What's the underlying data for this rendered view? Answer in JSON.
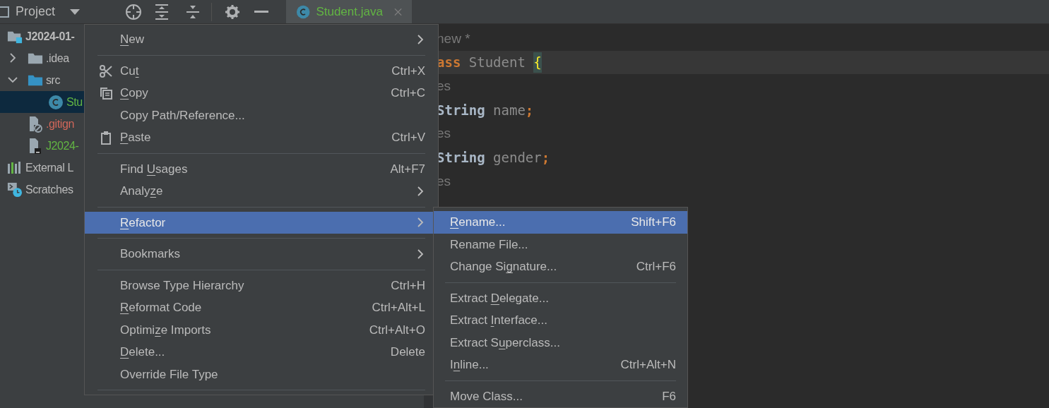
{
  "tool_window": {
    "title": "Project"
  },
  "editor_tabs": [
    {
      "label": "Student.java",
      "selected": true,
      "color": "#62b543"
    }
  ],
  "project_tree": [
    {
      "label": "J2024-01-",
      "kind": "module",
      "color": "#bbbbbb",
      "bold": true,
      "selected": false,
      "children": [
        {
          "label": ".idea",
          "kind": "folder",
          "color": "#bbbbbb",
          "expanded": false,
          "selected": false
        },
        {
          "label": "src",
          "kind": "source-folder",
          "color": "#bbbbbb",
          "expanded": true,
          "selected": false,
          "children": [
            {
              "label": "Stu",
              "kind": "class",
              "color": "#62b543",
              "selected": true
            }
          ]
        },
        {
          "label": ".gitign",
          "kind": "ignored-file",
          "color": "#d1675a",
          "selected": false
        },
        {
          "label": "J2024-",
          "kind": "module-file",
          "color": "#62b543",
          "selected": false
        }
      ]
    },
    {
      "label": "External L",
      "kind": "libraries",
      "color": "#bbbbbb",
      "selected": false
    },
    {
      "label": "Scratches",
      "kind": "scratches",
      "color": "#bbbbbb",
      "selected": false
    }
  ],
  "code_lines": [
    {
      "tokens": [
        {
          "text": "new *",
          "kind": "hint"
        }
      ]
    },
    {
      "tokens": [
        {
          "text": "ass",
          "kind": "keyword"
        },
        {
          "text": " Student ",
          "kind": "unused"
        },
        {
          "text": "{",
          "kind": "brace"
        }
      ],
      "current": true
    },
    {
      "tokens": [
        {
          "text": "es",
          "kind": "hint"
        }
      ]
    },
    {
      "tokens": [
        {
          "text": "String",
          "kind": "plain"
        },
        {
          "text": " name",
          "kind": "unused"
        },
        {
          "text": ";",
          "kind": "keyword"
        }
      ]
    },
    {
      "tokens": [
        {
          "text": "es",
          "kind": "hint"
        }
      ]
    },
    {
      "tokens": [
        {
          "text": "String",
          "kind": "plain"
        },
        {
          "text": " gender",
          "kind": "unused"
        },
        {
          "text": ";",
          "kind": "keyword"
        }
      ]
    },
    {
      "tokens": [
        {
          "text": "es",
          "kind": "hint"
        }
      ]
    }
  ],
  "context_menu": [
    {
      "kind": "item",
      "label": [
        {
          "text": "N",
          "underlined": true
        },
        {
          "text": "ew",
          "underlined": false
        }
      ],
      "submenu": true,
      "selected": false
    },
    {
      "kind": "separator"
    },
    {
      "kind": "cut",
      "label": [
        {
          "text": "Cu",
          "underlined": false
        },
        {
          "text": "t",
          "underlined": true
        }
      ],
      "shortcut": "Ctrl+X",
      "selected": false
    },
    {
      "kind": "copy",
      "label": [
        {
          "text": "C",
          "underlined": true
        },
        {
          "text": "opy",
          "underlined": false
        }
      ],
      "shortcut": "Ctrl+C",
      "selected": false
    },
    {
      "kind": "item",
      "label": [
        {
          "text": "Copy Path/Reference...",
          "underlined": false
        }
      ],
      "selected": false
    },
    {
      "kind": "paste",
      "label": [
        {
          "text": "P",
          "underlined": true
        },
        {
          "text": "aste",
          "underlined": false
        }
      ],
      "shortcut": "Ctrl+V",
      "selected": false
    },
    {
      "kind": "separator"
    },
    {
      "kind": "item",
      "label": [
        {
          "text": "Find ",
          "underlined": false
        },
        {
          "text": "U",
          "underlined": true
        },
        {
          "text": "sages",
          "underlined": false
        }
      ],
      "shortcut": "Alt+F7",
      "selected": false
    },
    {
      "kind": "item",
      "label": [
        {
          "text": "Analy",
          "underlined": false
        },
        {
          "text": "z",
          "underlined": true
        },
        {
          "text": "e",
          "underlined": false
        }
      ],
      "submenu": true,
      "selected": false
    },
    {
      "kind": "separator"
    },
    {
      "kind": "item",
      "label": [
        {
          "text": "R",
          "underlined": true
        },
        {
          "text": "efactor",
          "underlined": false
        }
      ],
      "submenu": true,
      "selected": true
    },
    {
      "kind": "separator"
    },
    {
      "kind": "item",
      "label": [
        {
          "text": "Bookmarks",
          "underlined": false
        }
      ],
      "submenu": true,
      "selected": false
    },
    {
      "kind": "separator"
    },
    {
      "kind": "item",
      "label": [
        {
          "text": "Browse Type Hierarchy",
          "underlined": false
        }
      ],
      "shortcut": "Ctrl+H",
      "selected": false
    },
    {
      "kind": "item",
      "label": [
        {
          "text": "R",
          "underlined": true
        },
        {
          "text": "eformat Code",
          "underlined": false
        }
      ],
      "shortcut": "Ctrl+Alt+L",
      "selected": false
    },
    {
      "kind": "item",
      "label": [
        {
          "text": "Optimi",
          "underlined": false
        },
        {
          "text": "z",
          "underlined": true
        },
        {
          "text": "e Imports",
          "underlined": false
        }
      ],
      "shortcut": "Ctrl+Alt+O",
      "selected": false
    },
    {
      "kind": "item",
      "label": [
        {
          "text": "D",
          "underlined": true
        },
        {
          "text": "elete...",
          "underlined": false
        }
      ],
      "shortcut": "Delete",
      "selected": false
    },
    {
      "kind": "item",
      "label": [
        {
          "text": "Override File Type",
          "underlined": false
        }
      ],
      "selected": false
    },
    {
      "kind": "separator"
    }
  ],
  "refactor_submenu": [
    {
      "kind": "item",
      "label": [
        {
          "text": "R",
          "underlined": true
        },
        {
          "text": "ename...",
          "underlined": false
        }
      ],
      "shortcut": "Shift+F6",
      "selected": true
    },
    {
      "kind": "item",
      "label": [
        {
          "text": "Rename File...",
          "underlined": false
        }
      ],
      "selected": false
    },
    {
      "kind": "item",
      "label": [
        {
          "text": "Change Si",
          "underlined": false
        },
        {
          "text": "g",
          "underlined": true
        },
        {
          "text": "nature...",
          "underlined": false
        }
      ],
      "shortcut": "Ctrl+F6",
      "selected": false
    },
    {
      "kind": "separator"
    },
    {
      "kind": "item",
      "label": [
        {
          "text": "Extract ",
          "underlined": false
        },
        {
          "text": "D",
          "underlined": true
        },
        {
          "text": "elegate...",
          "underlined": false
        }
      ],
      "selected": false
    },
    {
      "kind": "item",
      "label": [
        {
          "text": "Extract ",
          "underlined": false
        },
        {
          "text": "I",
          "underlined": true
        },
        {
          "text": "nterface...",
          "underlined": false
        }
      ],
      "selected": false
    },
    {
      "kind": "item",
      "label": [
        {
          "text": "Extract S",
          "underlined": false
        },
        {
          "text": "u",
          "underlined": true
        },
        {
          "text": "perclass...",
          "underlined": false
        }
      ],
      "selected": false
    },
    {
      "kind": "item",
      "label": [
        {
          "text": "I",
          "underlined": false
        },
        {
          "text": "n",
          "underlined": true
        },
        {
          "text": "line...",
          "underlined": false
        }
      ],
      "shortcut": "Ctrl+Alt+N",
      "selected": false
    },
    {
      "kind": "separator"
    },
    {
      "kind": "item",
      "label": [
        {
          "text": "Move Class...",
          "underlined": false
        }
      ],
      "shortcut": "F6",
      "selected": false
    }
  ]
}
